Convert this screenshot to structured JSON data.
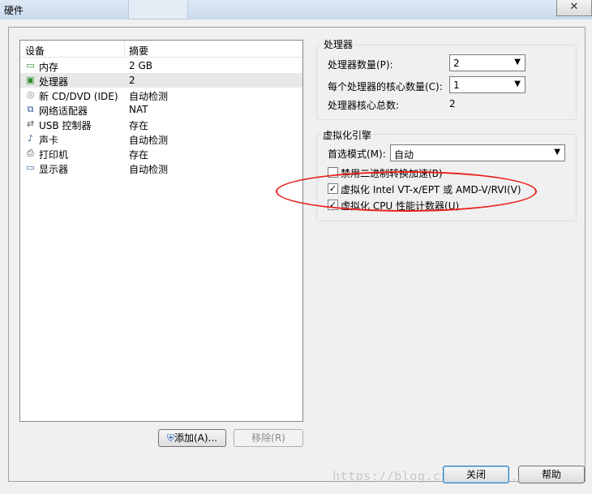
{
  "window": {
    "title": "硬件",
    "close_label": "✕"
  },
  "device_list": {
    "col_device": "设备",
    "col_summary": "摘要",
    "rows": [
      {
        "name": "内存",
        "summary": "2 GB",
        "icon": "memory-icon"
      },
      {
        "name": "处理器",
        "summary": "2",
        "icon": "processor-icon"
      },
      {
        "name": "新 CD/DVD (IDE)",
        "summary": "自动检测",
        "icon": "cd-dvd-icon"
      },
      {
        "name": "网络适配器",
        "summary": "NAT",
        "icon": "network-adapter-icon"
      },
      {
        "name": "USB 控制器",
        "summary": "存在",
        "icon": "usb-icon"
      },
      {
        "name": "声卡",
        "summary": "自动检测",
        "icon": "sound-card-icon"
      },
      {
        "name": "打印机",
        "summary": "存在",
        "icon": "printer-icon"
      },
      {
        "name": "显示器",
        "summary": "自动检测",
        "icon": "display-icon"
      }
    ],
    "selected_index": 1
  },
  "buttons": {
    "add": "添加(A)...",
    "remove": "移除(R)",
    "close": "关闭",
    "help": "帮助"
  },
  "processor_group": {
    "title": "处理器",
    "count_label": "处理器数量(P):",
    "count_value": "2",
    "cores_label": "每个处理器的核心数量(C):",
    "cores_value": "1",
    "total_label": "处理器核心总数:",
    "total_value": "2"
  },
  "virt_group": {
    "title": "虚拟化引擎",
    "mode_label": "首选模式(M):",
    "mode_value": "自动",
    "options": [
      {
        "label": "禁用二进制转换加速(B)",
        "checked": false
      },
      {
        "label": "虚拟化 Intel VT-x/EPT 或 AMD-V/RVI(V)",
        "checked": true
      },
      {
        "label": "虚拟化 CPU 性能计数器(U)",
        "checked": true
      }
    ]
  },
  "annotation_color": "#e8201c",
  "watermark": "https://blog.csdn.net/..._40"
}
